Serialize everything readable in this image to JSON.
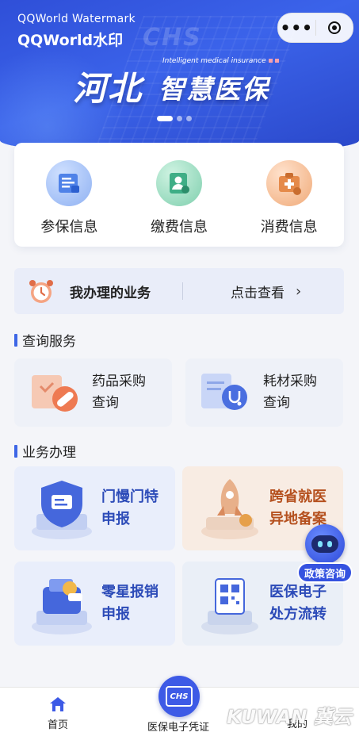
{
  "banner": {
    "watermark_line1": "QQWorld Watermark",
    "watermark_line2": "QQWorld水印",
    "logo_ghost": "CHS",
    "english_sub": "Intelligent medical insurance",
    "title_main": "河北",
    "title_sub": "智慧医保",
    "page_indicator": {
      "current": 1,
      "total": 3
    }
  },
  "capsule": {
    "more_icon": "more-dots-icon",
    "close_icon": "target-circle-icon"
  },
  "quick_menu": [
    {
      "label": "参保信息",
      "icon": "insurance-doc-icon",
      "color": "#4f82e8"
    },
    {
      "label": "缴费信息",
      "icon": "payment-user-icon",
      "color": "#3fae86"
    },
    {
      "label": "消费信息",
      "icon": "medical-kit-icon",
      "color": "#e58a4a"
    }
  ],
  "my_business": {
    "title": "我办理的业务",
    "action": "点击查看",
    "icon": "alarm-clock-icon"
  },
  "query_section": {
    "title": "查询服务",
    "items": [
      {
        "line1": "药品采购",
        "line2": "查询",
        "icon": "pill-icon"
      },
      {
        "line1": "耗材采购",
        "line2": "查询",
        "icon": "stethoscope-icon"
      }
    ]
  },
  "business_section": {
    "title": "业务办理",
    "items": [
      {
        "line1": "门慢门特",
        "line2": "申报",
        "icon": "shield-card-icon",
        "text_color": "#2c4bb8",
        "bg": "#e9eefb"
      },
      {
        "line1": "跨省就医",
        "line2": "异地备案",
        "icon": "rocket-icon",
        "text_color": "#b5501e",
        "bg": "#f8ece3"
      },
      {
        "line1": "零星报销",
        "line2": "申报",
        "icon": "wallet-coin-icon",
        "text_color": "#2c4bb8",
        "bg": "#e9eefb"
      },
      {
        "line1": "医保电子",
        "line2": "处方流转",
        "icon": "qr-code-icon",
        "text_color": "#2c4bb8",
        "bg": "#eaeff7"
      }
    ]
  },
  "policy_consult": {
    "label": "政策咨询",
    "icon": "chs-robot-icon"
  },
  "tabbar": {
    "home": "首页",
    "center": "医保电子凭证",
    "center_icon_text": "CHS",
    "mine": "我的"
  },
  "watermark_bottom": "KUWAN 冀云"
}
